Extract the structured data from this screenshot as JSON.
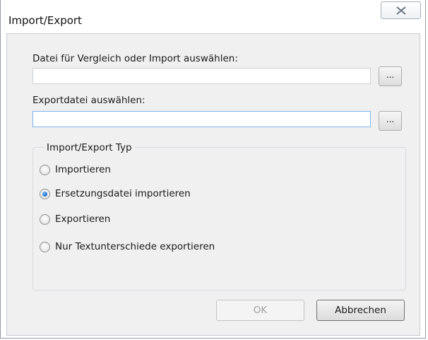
{
  "window": {
    "title": "Import/Export"
  },
  "compare_import": {
    "label": "Datei für Vergleich oder Import auswählen:",
    "value": "",
    "browse_label": "..."
  },
  "export": {
    "label": "Exportdatei auswählen:",
    "value": "",
    "browse_label": "..."
  },
  "type_group": {
    "title": "Import/Export Typ",
    "options": [
      {
        "label": "Importieren",
        "checked": false
      },
      {
        "label": "Ersetzungsdatei importieren",
        "checked": true
      },
      {
        "label": "Exportieren",
        "checked": false
      },
      {
        "label": "Nur Textunterschiede exportieren",
        "checked": false
      }
    ]
  },
  "buttons": {
    "ok_label": "OK",
    "ok_enabled": false,
    "cancel_label": "Abbrechen"
  },
  "icons": {
    "close": "close-icon"
  }
}
